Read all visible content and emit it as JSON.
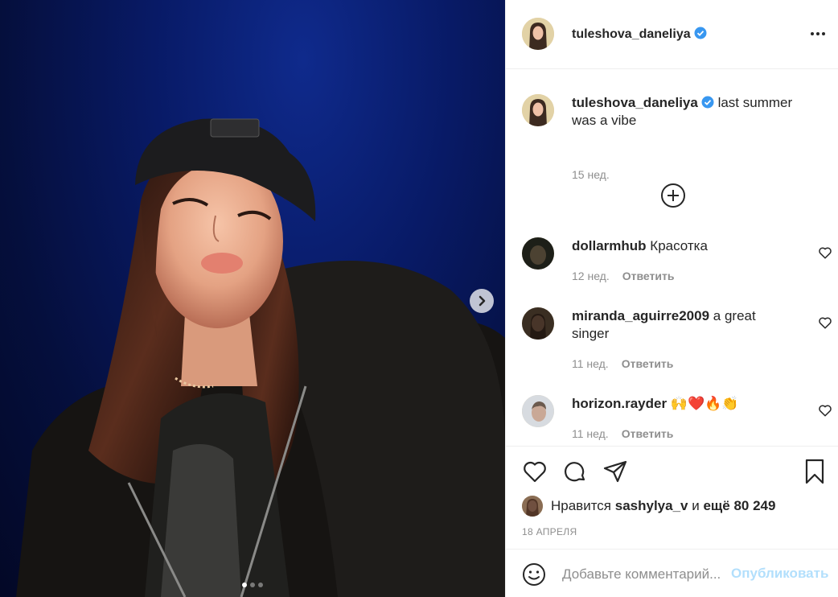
{
  "post": {
    "author": "tuleshova_daneliya",
    "verified_color": "#3897f0",
    "accent_color": "#0095f6"
  },
  "caption": {
    "username": "tuleshova_daneliya",
    "text": "last summer was a vibe",
    "time": "15 нед."
  },
  "comments": [
    {
      "username": "dollarmhub",
      "text": "Красотка",
      "time": "12 нед.",
      "reply": "Ответить"
    },
    {
      "username": "miranda_aguirre2009",
      "text": "a great singer",
      "time": "11 нед.",
      "reply": "Ответить"
    },
    {
      "username": "horizon.rayder",
      "text": "🙌❤️🔥👏",
      "time": "11 нед.",
      "reply": "Ответить"
    }
  ],
  "likes": {
    "prefix": "Нравится",
    "user": "sashylya_v",
    "conj": "и",
    "rest": "ещё 80 249"
  },
  "date": "18 АПРЕЛЯ",
  "add_comment": {
    "placeholder": "Добавьте комментарий...",
    "post_label": "Опубликовать"
  },
  "carousel": {
    "total": 3,
    "current": 1
  },
  "icons": {
    "more": "more-horizontal-icon",
    "like": "heart-icon",
    "comment": "comment-icon",
    "share": "share-icon",
    "save": "bookmark-icon",
    "emoji": "emoji-icon",
    "load_more": "plus-circle-icon",
    "next": "chevron-right-icon"
  }
}
